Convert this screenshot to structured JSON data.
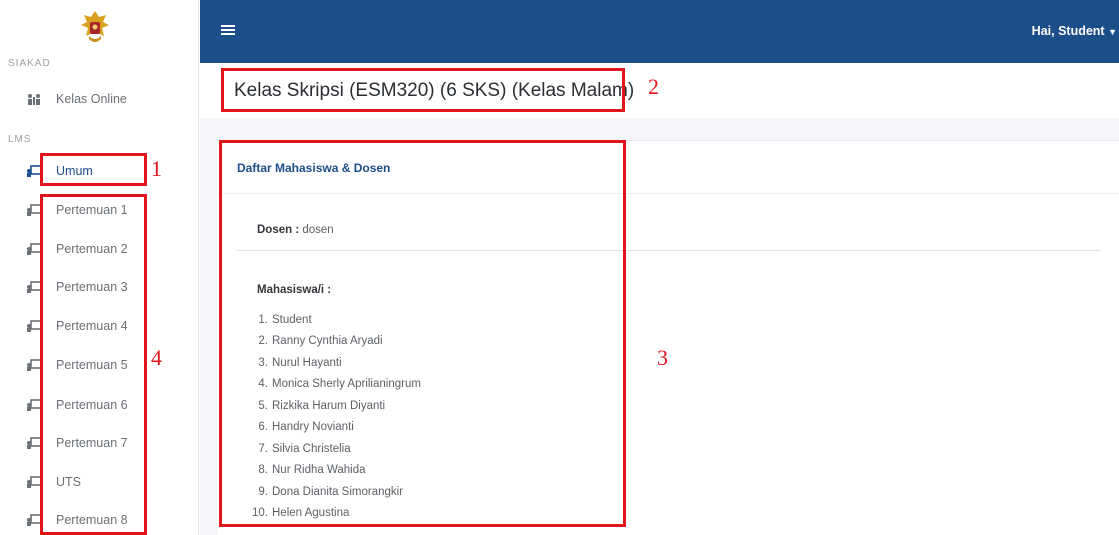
{
  "sidebar": {
    "siakad_label": "SIAKAD",
    "kelas_online": "Kelas Online",
    "lms_label": "LMS",
    "items": [
      {
        "label": "Umum",
        "active": true
      },
      {
        "label": "Pertemuan 1"
      },
      {
        "label": "Pertemuan 2"
      },
      {
        "label": "Pertemuan 3"
      },
      {
        "label": "Pertemuan 4"
      },
      {
        "label": "Pertemuan 5"
      },
      {
        "label": "Pertemuan 6"
      },
      {
        "label": "Pertemuan 7"
      },
      {
        "label": "UTS"
      },
      {
        "label": "Pertemuan 8"
      }
    ]
  },
  "topbar": {
    "menu_icon": "hamburger-icon",
    "user_greeting": "Hai, Student"
  },
  "page": {
    "title": "Kelas Skripsi (ESM320) (6 SKS) (Kelas Malam)"
  },
  "card": {
    "title": "Daftar Mahasiswa & Dosen",
    "dosen_label": "Dosen :",
    "dosen_value": "dosen",
    "mahasiswa_label": "Mahasiswa/i :",
    "mahasiswa": [
      {
        "no": "1.",
        "name": "Student"
      },
      {
        "no": "2.",
        "name": "Ranny Cynthia Aryadi"
      },
      {
        "no": "3.",
        "name": "Nurul Hayanti"
      },
      {
        "no": "4.",
        "name": "Monica Sherly Aprilianingrum"
      },
      {
        "no": "5.",
        "name": "Rizkika Harum Diyanti"
      },
      {
        "no": "6.",
        "name": "Handry Novianti"
      },
      {
        "no": "7.",
        "name": "Silvia Christelia"
      },
      {
        "no": "8.",
        "name": "Nur Ridha Wahida"
      },
      {
        "no": "9.",
        "name": "Dona Dianita Simorangkir"
      },
      {
        "no": "10.",
        "name": "Helen Agustina"
      }
    ]
  },
  "annotations": [
    "1",
    "2",
    "3",
    "4"
  ],
  "colors": {
    "accent": "#1c4f8a",
    "annotation": "#e0151c"
  }
}
